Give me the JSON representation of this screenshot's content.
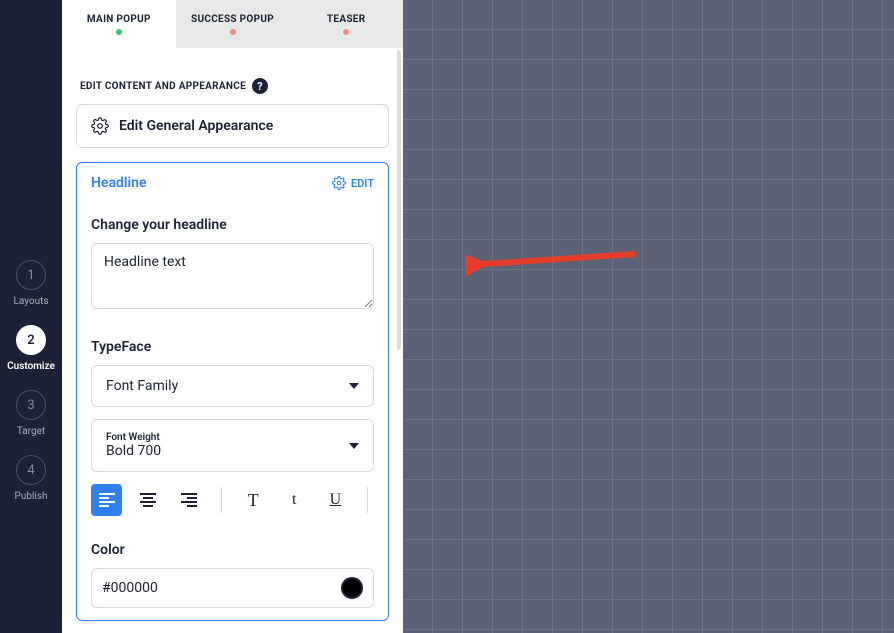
{
  "steps": [
    {
      "num": "1",
      "label": "Layouts",
      "active": false
    },
    {
      "num": "2",
      "label": "Customize",
      "active": true
    },
    {
      "num": "3",
      "label": "Target",
      "active": false
    },
    {
      "num": "4",
      "label": "Publish",
      "active": false
    }
  ],
  "tabs": {
    "main": "MAIN POPUP",
    "success": "SUCCESS POPUP",
    "teaser": "TEASER"
  },
  "section_label": "EDIT CONTENT AND APPEARANCE",
  "general_card": "Edit General Appearance",
  "headline": {
    "title": "Headline",
    "edit": "EDIT",
    "change_label": "Change your headline",
    "value": "Headline text",
    "typeface_label": "TypeFace",
    "font_family_placeholder": "Font Family",
    "font_weight_label": "Font Weight",
    "font_weight_value": "Bold 700",
    "color_label": "Color",
    "color_value": "#000000"
  }
}
